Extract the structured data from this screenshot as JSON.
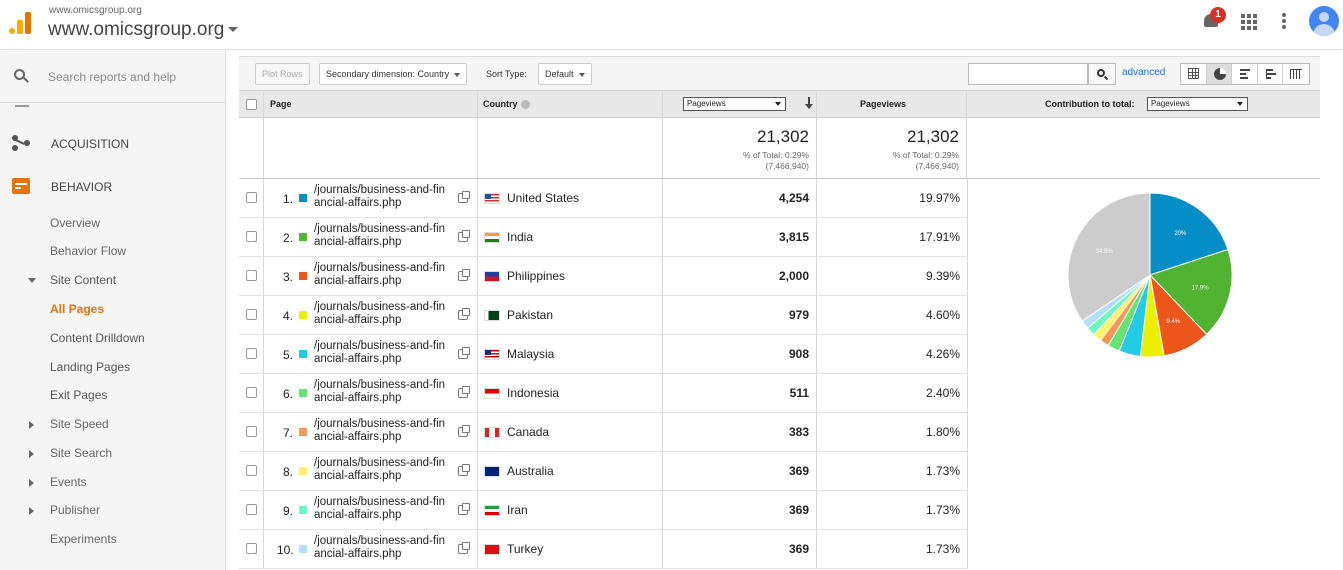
{
  "header": {
    "account_small": "www.omicsgroup.org",
    "account_name": "www.omicsgroup.org",
    "notification_count": "1"
  },
  "sidebar": {
    "search_placeholder": "Search reports and help",
    "sections": [
      {
        "label": "ACQUISITION",
        "icon": "acquisition-icon"
      },
      {
        "label": "BEHAVIOR",
        "icon": "behavior-icon"
      }
    ],
    "items": [
      {
        "label": "Overview"
      },
      {
        "label": "Behavior Flow"
      },
      {
        "label": "Site Content",
        "expanded": true
      },
      {
        "label": "All Pages",
        "active": true
      },
      {
        "label": "Content Drilldown"
      },
      {
        "label": "Landing Pages"
      },
      {
        "label": "Exit Pages"
      },
      {
        "label": "Site Speed"
      },
      {
        "label": "Site Search"
      },
      {
        "label": "Events"
      },
      {
        "label": "Publisher"
      },
      {
        "label": "Experiments"
      }
    ]
  },
  "toolbar": {
    "plot_rows": "Plot Rows",
    "secondary_dimension": "Secondary dimension: Country",
    "sort_type_label": "Sort Type:",
    "sort_type_value": "Default",
    "advanced": "advanced"
  },
  "table": {
    "headers": {
      "page": "Page",
      "country": "Country",
      "metric_select": "Pageviews",
      "pageviews": "Pageviews",
      "contribution": "Contribution to total:",
      "contribution_select": "Pageviews"
    },
    "totals": {
      "value1": "21,302",
      "pct1": "% of Total: 0.29%",
      "abs1": "(7,466,940)",
      "value2": "21,302",
      "pct2": "% of Total: 0.29%",
      "abs2": "(7,466,940)"
    },
    "rows": [
      {
        "num": "1.",
        "page1": "/journals/business-and-fin",
        "page2": "ancial-affairs.php",
        "country": "United States",
        "pageviews": "4,254",
        "pct": "19.97%",
        "color": "#058dc7"
      },
      {
        "num": "2.",
        "page1": "/journals/business-and-fin",
        "page2": "ancial-affairs.php",
        "country": "India",
        "pageviews": "3,815",
        "pct": "17.91%",
        "color": "#50b432"
      },
      {
        "num": "3.",
        "page1": "/journals/business-and-fin",
        "page2": "ancial-affairs.php",
        "country": "Philippines",
        "pageviews": "2,000",
        "pct": "9.39%",
        "color": "#ed561b"
      },
      {
        "num": "4.",
        "page1": "/journals/business-and-fin",
        "page2": "ancial-affairs.php",
        "country": "Pakistan",
        "pageviews": "979",
        "pct": "4.60%",
        "color": "#edef00"
      },
      {
        "num": "5.",
        "page1": "/journals/business-and-fin",
        "page2": "ancial-affairs.php",
        "country": "Malaysia",
        "pageviews": "908",
        "pct": "4.26%",
        "color": "#24cbe5"
      },
      {
        "num": "6.",
        "page1": "/journals/business-and-fin",
        "page2": "ancial-affairs.php",
        "country": "Indonesia",
        "pageviews": "511",
        "pct": "2.40%",
        "color": "#64e572"
      },
      {
        "num": "7.",
        "page1": "/journals/business-and-fin",
        "page2": "ancial-affairs.php",
        "country": "Canada",
        "pageviews": "383",
        "pct": "1.80%",
        "color": "#ff9655"
      },
      {
        "num": "8.",
        "page1": "/journals/business-and-fin",
        "page2": "ancial-affairs.php",
        "country": "Australia",
        "pageviews": "369",
        "pct": "1.73%",
        "color": "#fff263"
      },
      {
        "num": "9.",
        "page1": "/journals/business-and-fin",
        "page2": "ancial-affairs.php",
        "country": "Iran",
        "pageviews": "369",
        "pct": "1.73%",
        "color": "#6af9c4"
      },
      {
        "num": "10.",
        "page1": "/journals/business-and-fin",
        "page2": "ancial-affairs.php",
        "country": "Turkey",
        "pageviews": "369",
        "pct": "1.73%",
        "color": "#b2deff"
      }
    ]
  },
  "chart_data": {
    "type": "pie",
    "categories": [
      "United States",
      "India",
      "Philippines",
      "Pakistan",
      "Malaysia",
      "Indonesia",
      "Canada",
      "Australia",
      "Iran",
      "Turkey",
      "Other"
    ],
    "values": [
      19.97,
      17.91,
      9.39,
      4.6,
      4.26,
      2.4,
      1.8,
      1.73,
      1.73,
      1.73,
      34.5
    ],
    "colors": [
      "#058dc7",
      "#50b432",
      "#ed561b",
      "#edef00",
      "#24cbe5",
      "#64e572",
      "#ff9655",
      "#fff263",
      "#6af9c4",
      "#b2deff",
      "#cccccc"
    ],
    "labels": [
      "20%",
      "17.9%",
      "9.4%",
      "",
      "",
      "",
      "",
      "",
      "",
      "",
      "34.5%"
    ]
  }
}
